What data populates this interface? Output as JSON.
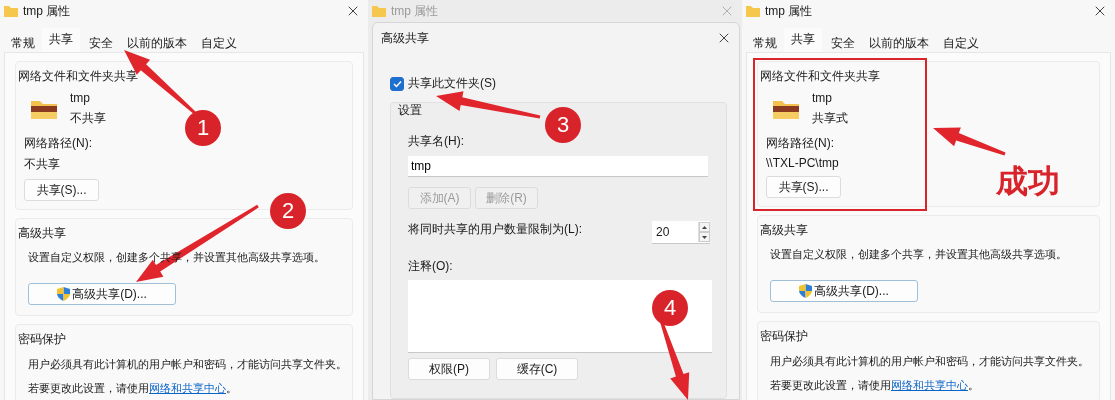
{
  "windows": [
    {
      "kind": "properties",
      "title": "tmp 属性",
      "tabs": [
        {
          "label": "常规",
          "selected": false
        },
        {
          "label": "共享",
          "selected": true
        },
        {
          "label": "安全",
          "selected": false
        },
        {
          "label": "以前的版本",
          "selected": false
        },
        {
          "label": "自定义",
          "selected": false
        }
      ],
      "sharing_group": {
        "title": "网络文件和文件夹共享",
        "folder_name": "tmp",
        "status": "不共享",
        "path_label": "网络路径(N):",
        "path": "不共享",
        "share_button": "共享(S)...",
        "highlighted": false
      },
      "advanced_group": {
        "title": "高级共享",
        "description": "设置自定义权限，创建多个共享，并设置其他高级共享选项。",
        "button": "高级共享(D)..."
      },
      "password_group": {
        "title": "密码保护",
        "description": "用户必须具有此计算机的用户帐户和密码，才能访问共享文件夹。",
        "note": "若要更改此设置，请使用",
        "link": "网络和共享中心",
        "note_end": "。"
      }
    },
    {
      "kind": "advanced_sharing",
      "background_title": "tmp 属性",
      "title": "高级共享",
      "share_checkbox": {
        "label": "共享此文件夹(S)",
        "checked": true
      },
      "settings_group": {
        "title": "设置",
        "share_name_label": "共享名(H):",
        "share_name": "tmp",
        "add_button": {
          "label": "添加(A)",
          "disabled": true
        },
        "remove_button": {
          "label": "删除(R)",
          "disabled": true
        },
        "user_limit_label": "将同时共享的用户数量限制为(L):",
        "user_limit": "20",
        "comment_label": "注释(O):",
        "buttons": [
          "权限(P)",
          "缓存(C)"
        ]
      }
    },
    {
      "kind": "properties",
      "title": "tmp 属性",
      "tabs": [
        {
          "label": "常规",
          "selected": false
        },
        {
          "label": "共享",
          "selected": true
        },
        {
          "label": "安全",
          "selected": false
        },
        {
          "label": "以前的版本",
          "selected": false
        },
        {
          "label": "自定义",
          "selected": false
        }
      ],
      "sharing_group": {
        "title": "网络文件和文件夹共享",
        "folder_name": "tmp",
        "status": "共享式",
        "path_label": "网络路径(N):",
        "path": "\\\\TXL-PC\\tmp",
        "share_button": "共享(S)...",
        "highlighted": true
      },
      "advanced_group": {
        "title": "高级共享",
        "description": "设置自定义权限，创建多个共享，并设置其他高级共享选项。",
        "button": "高级共享(D)..."
      },
      "password_group": {
        "title": "密码保护",
        "description": "用户必须具有此计算机的用户帐户和密码，才能访问共享文件夹。",
        "note": "若要更改此设置，请使用",
        "link": "网络和共享中心",
        "note_end": "。"
      }
    }
  ],
  "annotations": [
    {
      "kind": "badge",
      "label": "1"
    },
    {
      "kind": "badge",
      "label": "2"
    },
    {
      "kind": "badge",
      "label": "3"
    },
    {
      "kind": "badge",
      "label": "4"
    },
    {
      "kind": "caption",
      "label": "成功"
    }
  ]
}
